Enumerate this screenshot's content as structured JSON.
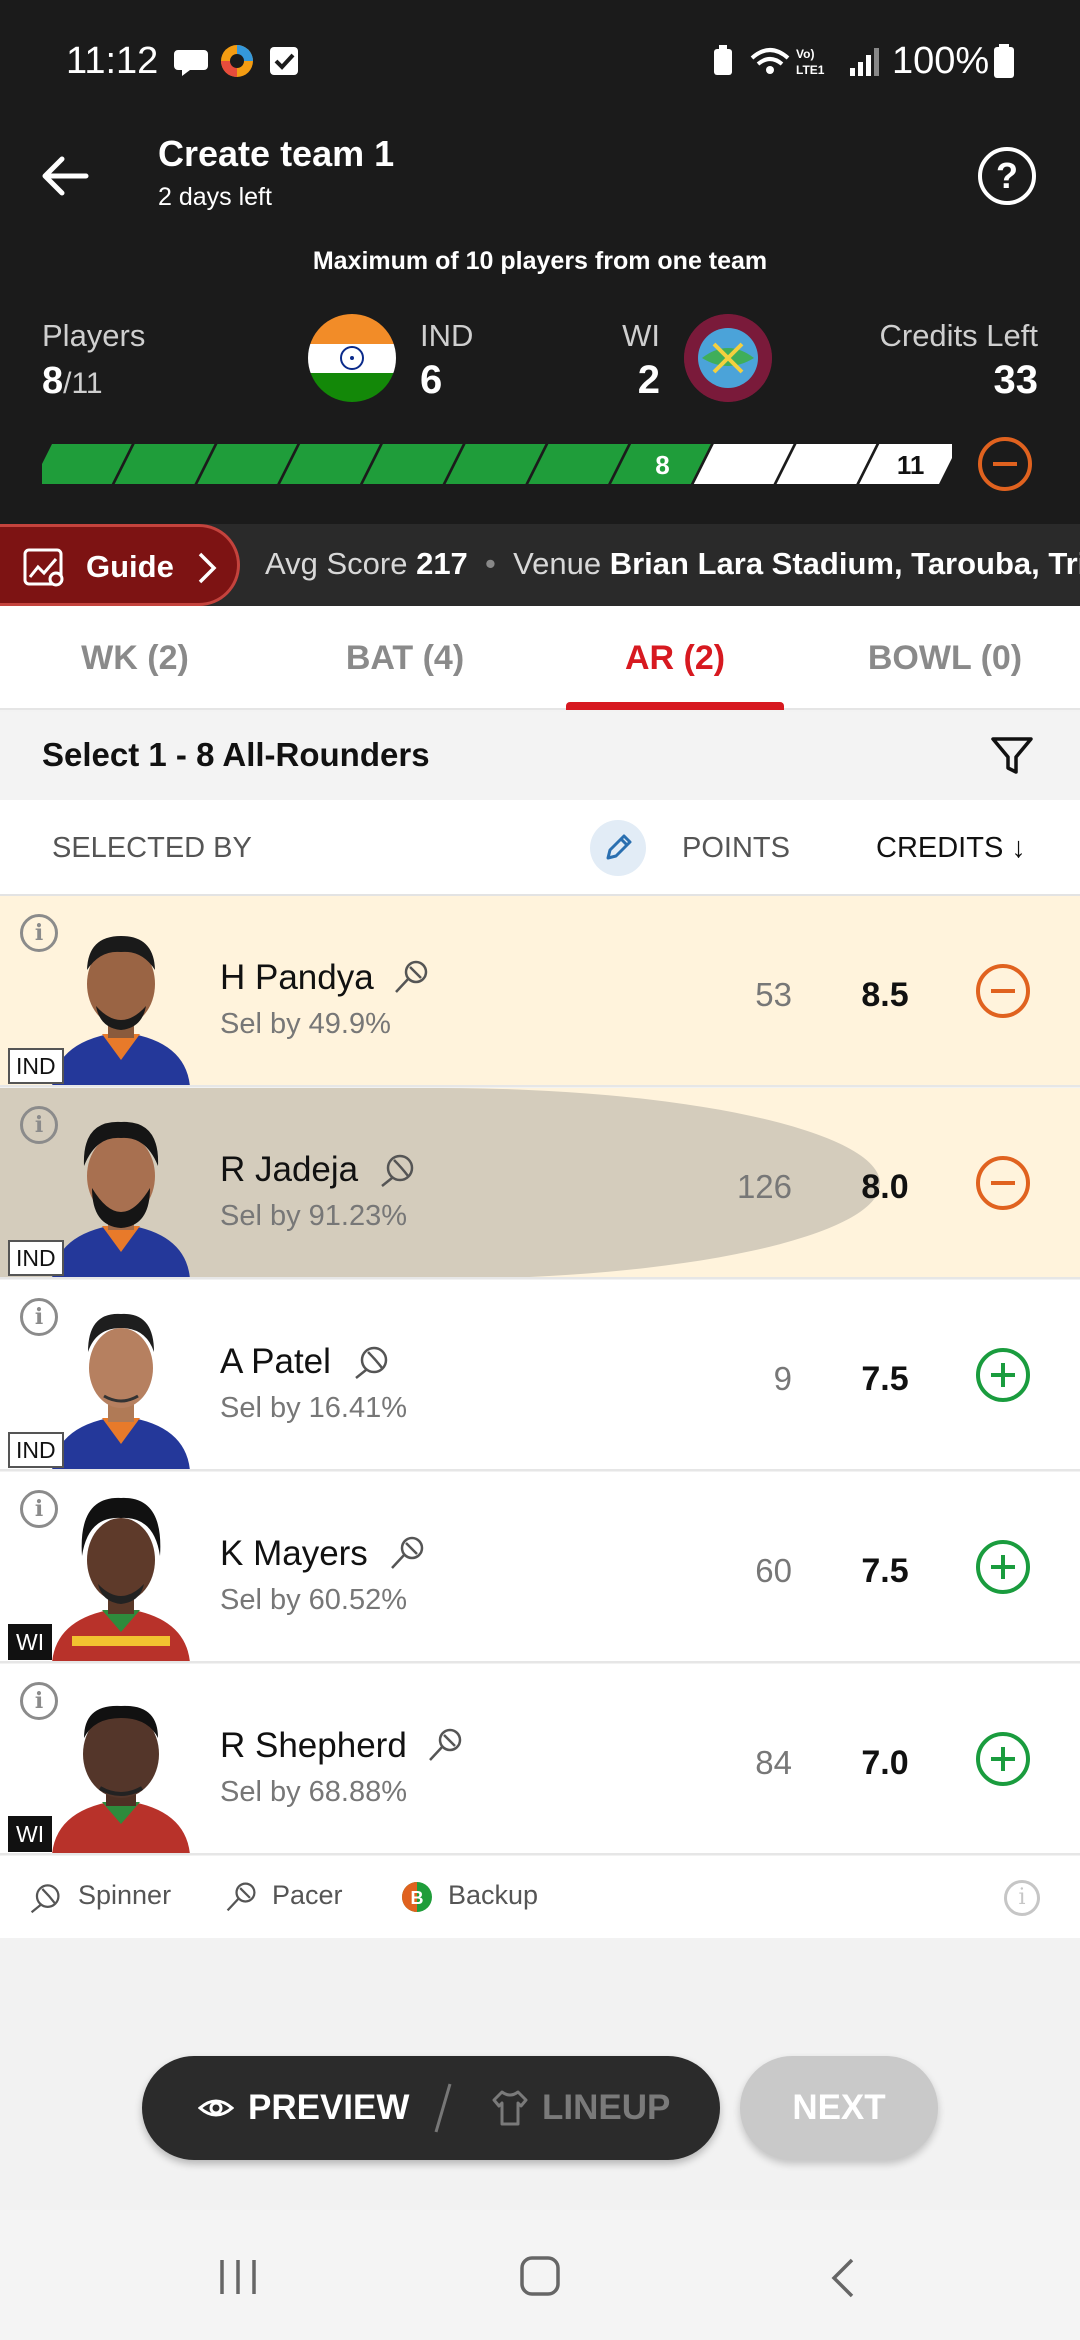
{
  "status_bar": {
    "time": "11:12",
    "battery": "100%",
    "network": "Vo) LTE1"
  },
  "header": {
    "title": "Create team 1",
    "subtitle": "2 days left",
    "max_note": "Maximum of 10 players from one team"
  },
  "summary": {
    "players_label": "Players",
    "players_selected": "8",
    "players_total": "/11",
    "team1_name": "IND",
    "team1_count": "6",
    "team2_name": "WI",
    "team2_count": "2",
    "credits_label": "Credits Left",
    "credits_left": "33",
    "progress_selected": 8,
    "progress_total": 11,
    "progress_selected_label": "8",
    "progress_total_label": "11"
  },
  "strip": {
    "guide_label": "Guide",
    "avg_score_label": "Avg Score",
    "avg_score": "217",
    "venue_label": "Venue",
    "venue": "Brian Lara Stadium, Tarouba, Trin"
  },
  "tabs": [
    {
      "label": "WK (2)"
    },
    {
      "label": "BAT (4)"
    },
    {
      "label": "AR (2)"
    },
    {
      "label": "BOWL (0)"
    }
  ],
  "select_title": "Select 1 - 8 All-Rounders",
  "sort_header": {
    "selected_by": "SELECTED BY",
    "points": "POINTS",
    "credits": "CREDITS ↓"
  },
  "players": [
    {
      "name": "H Pandya",
      "sel": "Sel by 49.9%",
      "points": "53",
      "credits": "8.5",
      "team": "IND",
      "role": "pacer-icon",
      "selected": true
    },
    {
      "name": "R Jadeja",
      "sel": "Sel by 91.23%",
      "points": "126",
      "credits": "8.0",
      "team": "IND",
      "role": "spinner-icon",
      "selected": true
    },
    {
      "name": "A Patel",
      "sel": "Sel by 16.41%",
      "points": "9",
      "credits": "7.5",
      "team": "IND",
      "role": "spinner-icon",
      "selected": false
    },
    {
      "name": "K Mayers",
      "sel": "Sel by 60.52%",
      "points": "60",
      "credits": "7.5",
      "team": "WI",
      "role": "pacer-icon",
      "selected": false
    },
    {
      "name": "R Shepherd",
      "sel": "Sel by 68.88%",
      "points": "84",
      "credits": "7.0",
      "team": "WI",
      "role": "pacer-icon",
      "selected": false
    }
  ],
  "legend": {
    "spinner": "Spinner",
    "pacer": "Pacer",
    "backup": "Backup"
  },
  "bottom": {
    "preview": "PREVIEW",
    "lineup": "LINEUP",
    "next": "NEXT"
  },
  "colors": {
    "accent_red": "#d71920",
    "progress_green": "#1f9d3a",
    "remove_orange": "#e0621f",
    "add_green": "#1a9c3e",
    "header_bg": "#1b1b1b"
  }
}
